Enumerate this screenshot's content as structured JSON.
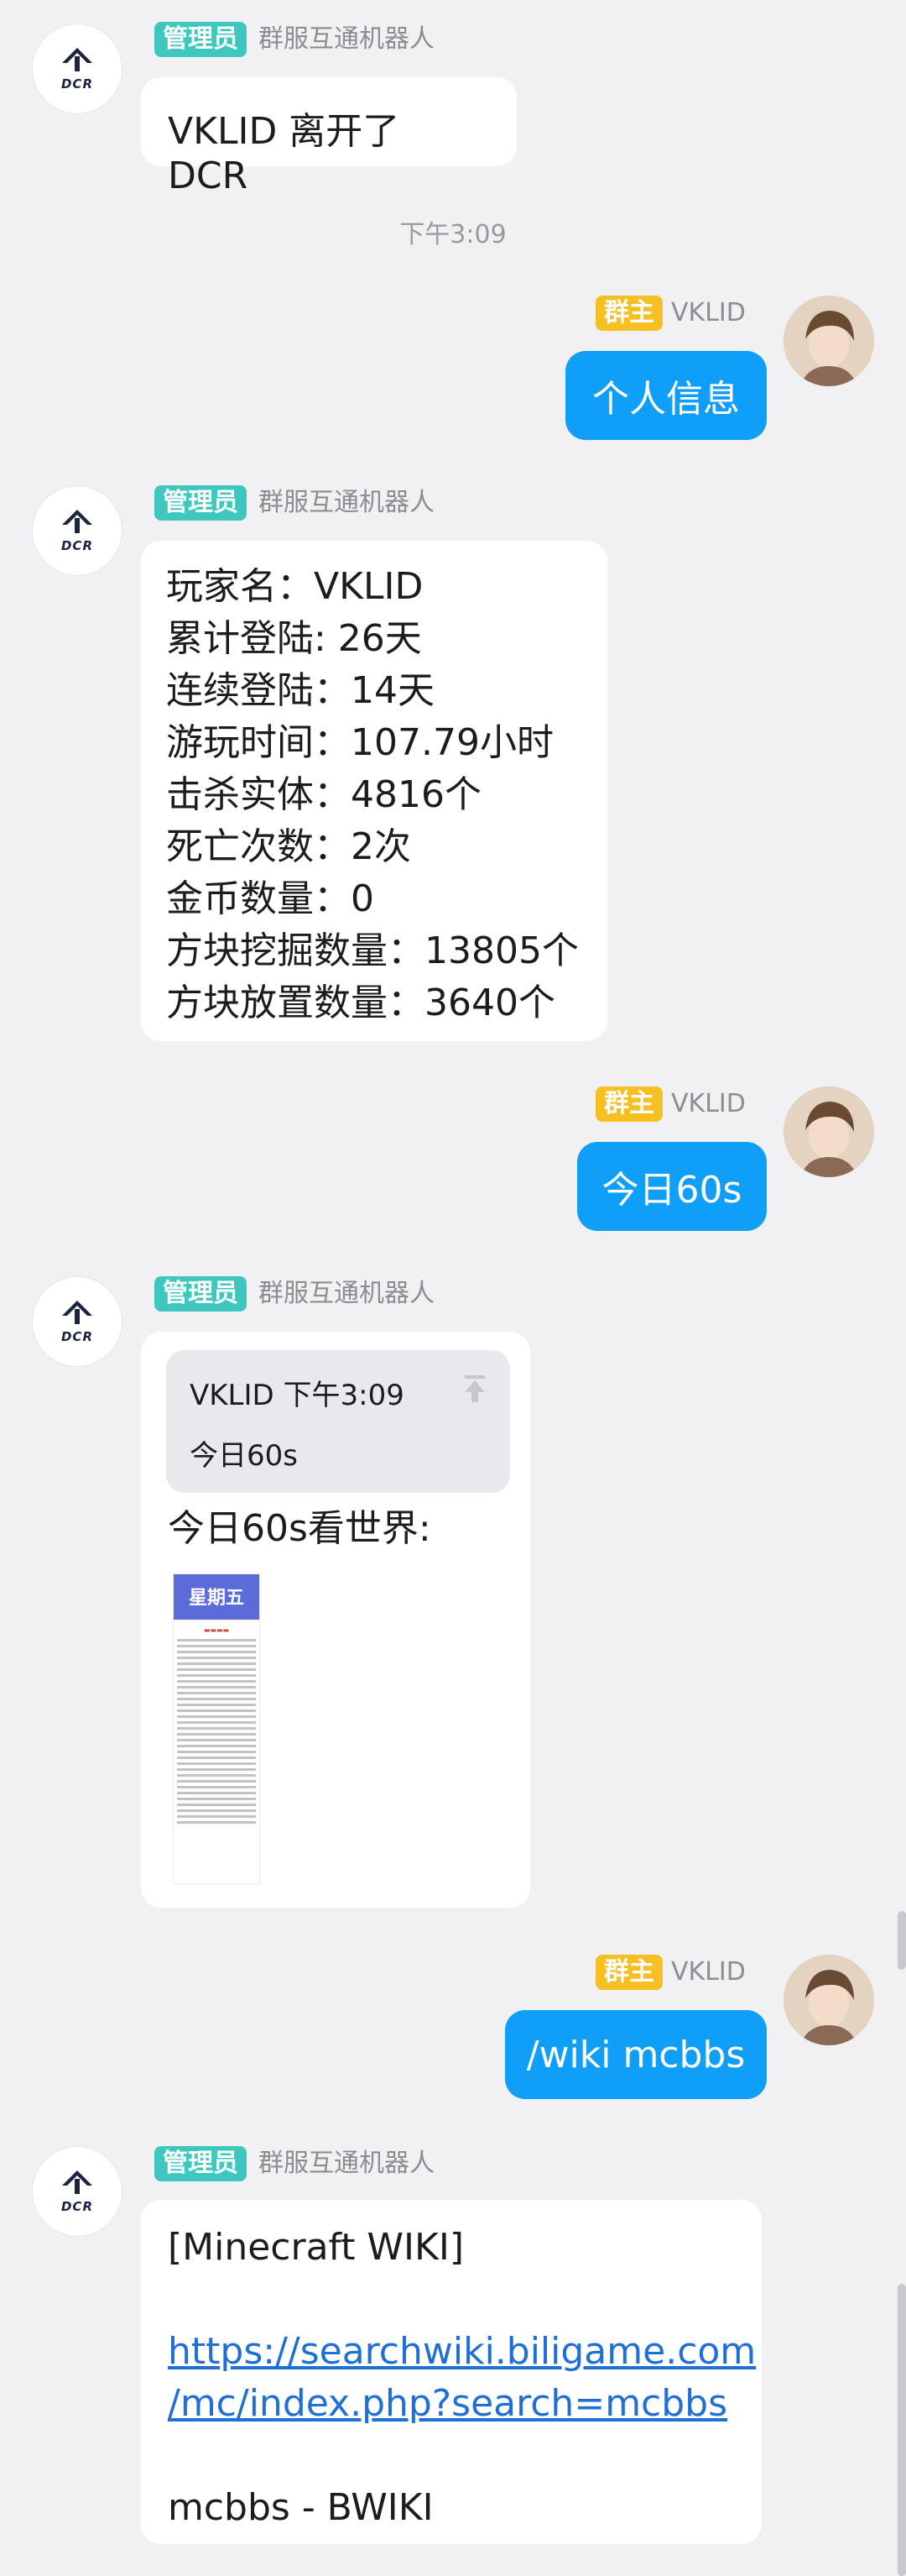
{
  "messages": {
    "m1": {
      "badge": "管理员",
      "sender": "群服互通机器人",
      "text": "VKLID 离开了 DCR"
    },
    "time1": "下午3:09",
    "m2": {
      "badge": "群主",
      "sender": "VKLID",
      "text": "个人信息"
    },
    "m3": {
      "badge": "管理员",
      "sender": "群服互通机器人",
      "lines": [
        "玩家名：VKLID",
        "累计登陆: 26天",
        "连续登陆：14天",
        "游玩时间：107.79小时",
        "击杀实体：4816个",
        "死亡次数：2次",
        "金币数量：0",
        "方块挖掘数量：13805个",
        "方块放置数量：3640个"
      ]
    },
    "m4": {
      "badge": "群主",
      "sender": "VKLID",
      "text": "今日60s"
    },
    "m5": {
      "badge": "管理员",
      "sender": "群服互通机器人",
      "quote_header": "VKLID 下午3:09",
      "quote_text": "今日60s",
      "text": "今日60s看世界:",
      "thumb_title": "星期五"
    },
    "m6": {
      "badge": "群主",
      "sender": "VKLID",
      "text": "/wiki mcbbs"
    },
    "m7": {
      "badge": "管理员",
      "sender": "群服互通机器人",
      "title": "[Minecraft WIKI]",
      "link_line1": "https://searchwiki.biligame.com",
      "link_line2": "/mc/index.php?search=mcbbs",
      "footer": "mcbbs - BWIKI"
    }
  },
  "logo": {
    "text": "DCR"
  },
  "colors": {
    "self_bubble": "#0f9ef8",
    "admin_badge": "#3dc7be",
    "owner_badge": "#f6bf22"
  }
}
